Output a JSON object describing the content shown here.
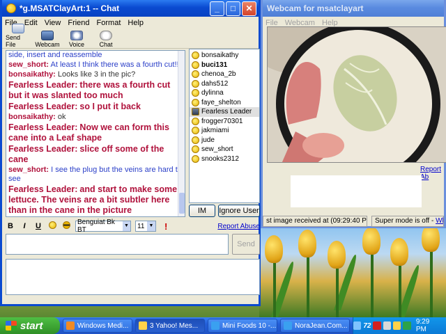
{
  "chat_window": {
    "title": "*g.MSATClayArt:1 -- Chat",
    "menu": [
      "File",
      "Edit",
      "View",
      "Friend",
      "Format",
      "Help"
    ],
    "toolbar": [
      {
        "label": "Send File",
        "icon": "send-file-icon"
      },
      {
        "label": "Webcam",
        "icon": "webcam-icon"
      },
      {
        "label": "Voice",
        "icon": "voice-icon"
      },
      {
        "label": "Chat",
        "icon": "chat-icon"
      }
    ],
    "messages": [
      {
        "nick": "",
        "text": "side, insert and reassemble",
        "style": "top"
      },
      {
        "nick": "sew_short:",
        "text": "At least I think there was a fourth cut!!",
        "style": "sew"
      },
      {
        "nick": "bonsaikathy:",
        "text": "Looks like 3 in the pic?",
        "style": "bon"
      },
      {
        "nick": "Fearless Leader:",
        "text": "there was a fourth cut but it was slanted too much",
        "style": "fl"
      },
      {
        "nick": "Fearless Leader:",
        "text": "so I put it back",
        "style": "fl"
      },
      {
        "nick": "bonsaikathy:",
        "text": "ok",
        "style": "bon"
      },
      {
        "nick": "Fearless Leader:",
        "text": "Now we can form this cane into a Leaf shape",
        "style": "fl"
      },
      {
        "nick": "Fearless Leader:",
        "text": "slice off some of the cane",
        "style": "fl"
      },
      {
        "nick": "sew_short:",
        "text": "I see the plug but the veins are hard to see",
        "style": "sew"
      },
      {
        "nick": "Fearless Leader:",
        "text": "and start to make some lettuce. The veins are a bit subtler here than in the cane in the picture",
        "style": "fl"
      }
    ],
    "users": [
      {
        "name": "bonsaikathy",
        "bold": false,
        "selected": false,
        "webcam": false
      },
      {
        "name": "buci131",
        "bold": true,
        "selected": false,
        "webcam": false
      },
      {
        "name": "chenoa_2b",
        "bold": false,
        "selected": false,
        "webcam": false
      },
      {
        "name": "dahs512",
        "bold": false,
        "selected": false,
        "webcam": false
      },
      {
        "name": "dylinna",
        "bold": false,
        "selected": false,
        "webcam": false
      },
      {
        "name": "faye_shelton",
        "bold": false,
        "selected": false,
        "webcam": false
      },
      {
        "name": "Fearless Leader",
        "bold": false,
        "selected": true,
        "webcam": true
      },
      {
        "name": "frogger70301",
        "bold": false,
        "selected": false,
        "webcam": false
      },
      {
        "name": "jakmiami",
        "bold": false,
        "selected": false,
        "webcam": false
      },
      {
        "name": "jude",
        "bold": false,
        "selected": false,
        "webcam": false
      },
      {
        "name": "sew_short",
        "bold": false,
        "selected": false,
        "webcam": false
      },
      {
        "name": "snooks2312",
        "bold": false,
        "selected": false,
        "webcam": false
      }
    ],
    "im_button": "IM",
    "ignore_button": "Ignore User",
    "format": {
      "bold": "B",
      "italic": "I",
      "underline": "U",
      "font": "Benguiat Bk BT",
      "size": "11",
      "report_abuse": "Report Abuse"
    },
    "send_button": "Send"
  },
  "webcam_window": {
    "title": "Webcam for msatclayart",
    "menu": [
      "File",
      "Webcam",
      "Help"
    ],
    "report_link": "Report Ab",
    "status_last_image": "st image received at (09:29:40 PM)",
    "status_mode": "Super mode is off -",
    "status_link": "What's th"
  },
  "taskbar": {
    "start_label": "start",
    "tasks": [
      {
        "label": "Windows Medi...",
        "icon": "media-player-icon",
        "active": false
      },
      {
        "label": "3 Yahoo! Mes...",
        "icon": "yahoo-messenger-icon",
        "active": true
      },
      {
        "label": "Mini Foods 10 -...",
        "icon": "browser-icon",
        "active": false
      },
      {
        "label": "NoraJean.Com...",
        "icon": "browser-icon",
        "active": false
      }
    ],
    "tray_badge": "72",
    "clock": "9:29 PM"
  },
  "colors": {
    "xp_blue": "#0a4ad0",
    "chat_red": "#b0123c",
    "chat_blue": "#2b3fc8",
    "start_green": "#2f8f26"
  }
}
